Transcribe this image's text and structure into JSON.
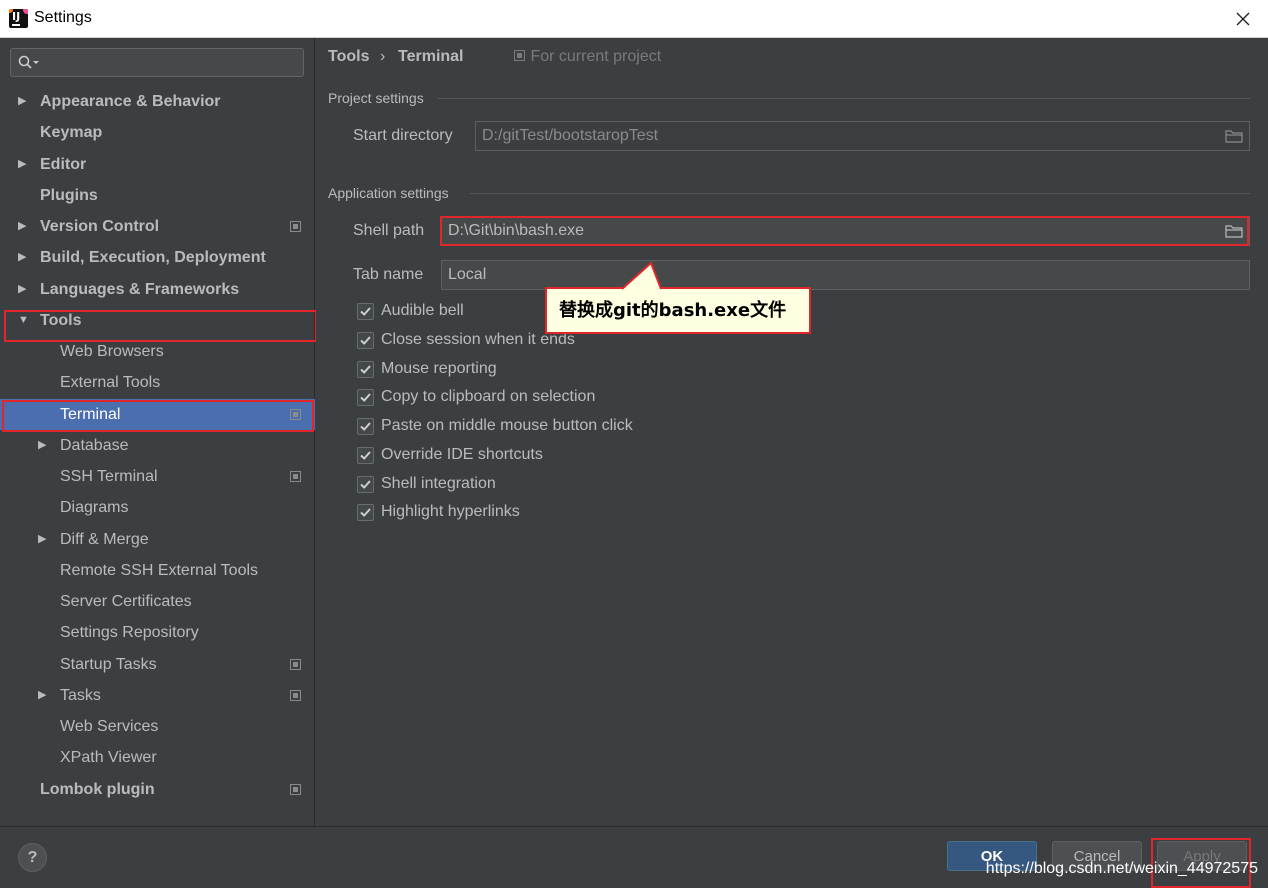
{
  "window": {
    "title": "Settings"
  },
  "search": {
    "placeholder": ""
  },
  "sidebar": {
    "items": [
      {
        "label": "Appearance & Behavior"
      },
      {
        "label": "Keymap"
      },
      {
        "label": "Editor"
      },
      {
        "label": "Plugins"
      },
      {
        "label": "Version Control"
      },
      {
        "label": "Build, Execution, Deployment"
      },
      {
        "label": "Languages & Frameworks"
      },
      {
        "label": "Tools"
      },
      {
        "label": "Web Browsers"
      },
      {
        "label": "External Tools"
      },
      {
        "label": "Terminal"
      },
      {
        "label": "Database"
      },
      {
        "label": "SSH Terminal"
      },
      {
        "label": "Diagrams"
      },
      {
        "label": "Diff & Merge"
      },
      {
        "label": "Remote SSH External Tools"
      },
      {
        "label": "Server Certificates"
      },
      {
        "label": "Settings Repository"
      },
      {
        "label": "Startup Tasks"
      },
      {
        "label": "Tasks"
      },
      {
        "label": "Web Services"
      },
      {
        "label": "XPath Viewer"
      },
      {
        "label": "Lombok plugin"
      }
    ]
  },
  "breadcrumb": {
    "parent": "Tools",
    "separator": "›",
    "current": "Terminal",
    "scope": "For current project"
  },
  "project_settings": {
    "title": "Project settings",
    "start_directory_label": "Start directory",
    "start_directory_value": "D:/gitTest/bootstaropTest"
  },
  "app_settings": {
    "title": "Application settings",
    "shell_path_label": "Shell path",
    "shell_path_value": "D:\\Git\\bin\\bash.exe",
    "tab_name_label": "Tab name",
    "tab_name_value": "Local",
    "checkboxes": [
      {
        "label": "Audible bell",
        "checked": true
      },
      {
        "label": "Close session when it ends",
        "checked": true
      },
      {
        "label": "Mouse reporting",
        "checked": true
      },
      {
        "label": "Copy to clipboard on selection",
        "checked": true
      },
      {
        "label": "Paste on middle mouse button click",
        "checked": true
      },
      {
        "label": "Override IDE shortcuts",
        "checked": true
      },
      {
        "label": "Shell integration",
        "checked": true
      },
      {
        "label": "Highlight hyperlinks",
        "checked": true
      }
    ]
  },
  "callout": {
    "text": "替换成git的bash.exe文件"
  },
  "footer": {
    "help": "?",
    "ok": "OK",
    "cancel": "Cancel",
    "apply": "Apply",
    "watermark": "https://blog.csdn.net/weixin_44972575"
  },
  "colors": {
    "selection": "#4b6eaf",
    "highlight": "#e0262b",
    "primary_button": "#365880",
    "background": "#3c3f41"
  }
}
